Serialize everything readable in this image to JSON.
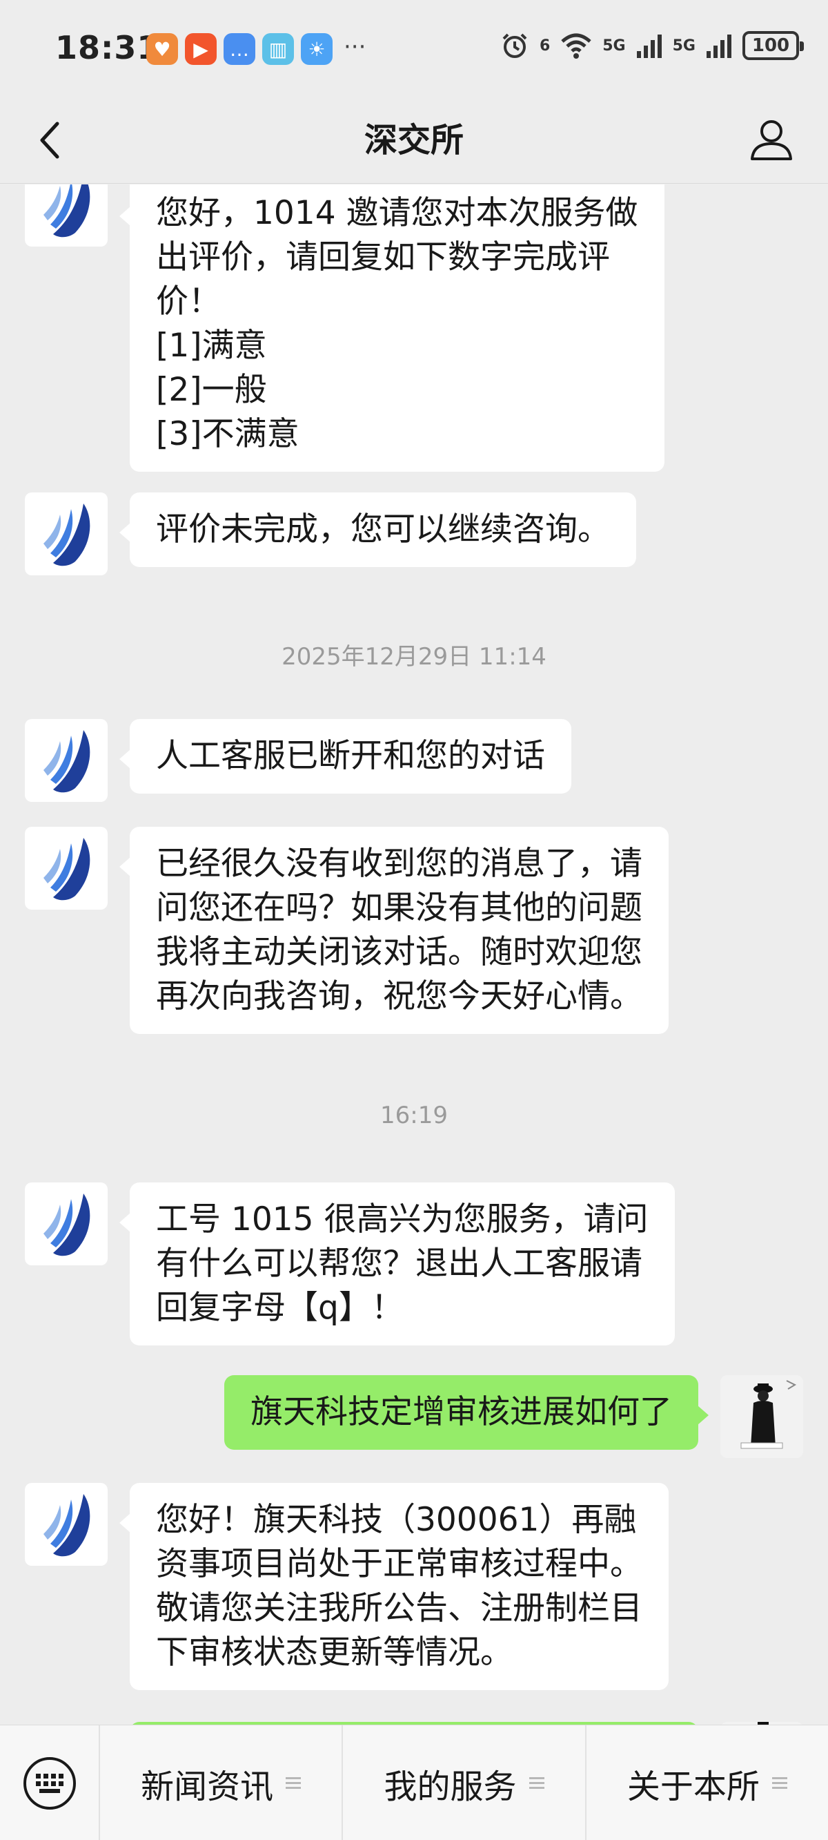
{
  "status_bar": {
    "time": "18:31",
    "wifi_label": "6",
    "signal1_label": "5G",
    "signal2_label": "5G",
    "battery": "100"
  },
  "header": {
    "title": "深交所"
  },
  "messages": [
    {
      "side": "left",
      "text": "您好，1014 邀请您对本次服务做\n出评价，请回复如下数字完成评\n价！\n[1]满意\n[2]一般\n[3]不满意"
    },
    {
      "side": "left",
      "text": "评价未完成，您可以继续咨询。"
    },
    {
      "type": "time",
      "text": "2025年12月29日 11:14"
    },
    {
      "side": "left",
      "text": "人工客服已断开和您的对话"
    },
    {
      "side": "left",
      "text": "已经很久没有收到您的消息了，请\n问您还在吗？如果没有其他的问题\n我将主动关闭该对话。随时欢迎您\n再次向我咨询，祝您今天好心情。"
    },
    {
      "type": "time",
      "text": "16:19"
    },
    {
      "side": "left",
      "text": "工号 1015 很高兴为您服务，请问\n有什么可以帮您？退出人工客服请\n回复字母【q】！"
    },
    {
      "side": "right",
      "text": "旗天科技定增审核进展如何了"
    },
    {
      "side": "left",
      "text": "您好！旗天科技（300061）再融\n资事项目尚处于正常审核过程中。\n敬请您关注我所公告、注册制栏目\n下审核状态更新等情况。"
    }
  ],
  "bottom_menu": {
    "tabs": [
      "新闻资讯",
      "我的服务",
      "关于本所"
    ]
  },
  "colors": {
    "background": "#ededed",
    "self_bubble": "#95ec69",
    "other_bubble": "#ffffff",
    "timestamp": "#9a9a9a"
  },
  "icons": {
    "back": "chevron-left-icon",
    "profile": "person-icon",
    "keyboard": "keyboard-icon",
    "menu": "menu-lines-icon",
    "bot_avatar": "szse-shield-logo"
  }
}
